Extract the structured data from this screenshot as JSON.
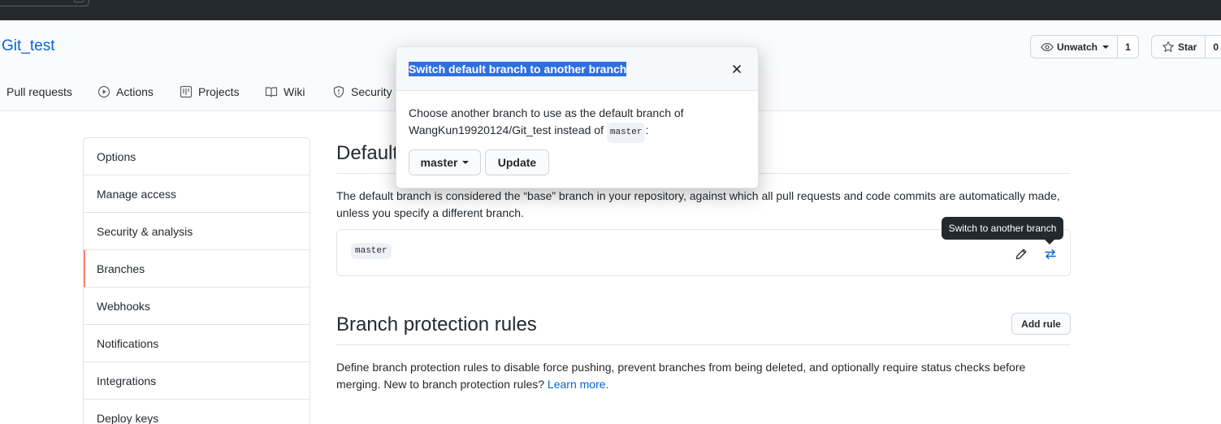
{
  "repo": {
    "name": "Git_test"
  },
  "header_actions": {
    "watch_label": "Unwatch",
    "watch_count": "1",
    "star_label": "Star",
    "star_count": "0"
  },
  "tabs": [
    {
      "label": "Pull requests",
      "icon": "pull-request-icon"
    },
    {
      "label": "Actions",
      "icon": "play-icon"
    },
    {
      "label": "Projects",
      "icon": "project-icon"
    },
    {
      "label": "Wiki",
      "icon": "book-icon"
    },
    {
      "label": "Security",
      "icon": "shield-icon"
    }
  ],
  "sidebar": {
    "items": [
      {
        "label": "Options"
      },
      {
        "label": "Manage access"
      },
      {
        "label": "Security & analysis"
      },
      {
        "label": "Branches",
        "selected": true
      },
      {
        "label": "Webhooks"
      },
      {
        "label": "Notifications"
      },
      {
        "label": "Integrations"
      },
      {
        "label": "Deploy keys"
      }
    ]
  },
  "default_branch": {
    "title": "Default",
    "description": "The default branch is considered the “base” branch in your repository, against which all pull requests and code commits are automatically made, unless you specify a different branch.",
    "branch": "master",
    "edit_icon": "pencil-icon",
    "switch_icon": "arrow-switch-icon",
    "tooltip": "Switch to another branch"
  },
  "protection": {
    "title": "Branch protection rules",
    "add_rule_label": "Add rule",
    "description": "Define branch protection rules to disable force pushing, prevent branches from being deleted, and optionally require status checks before merging. New to branch protection rules?",
    "learn_more": "Learn more."
  },
  "modal": {
    "title": "Switch default branch to another branch",
    "body_line1": "Choose another branch to use as the default branch of",
    "body_repo": "WangKun19920124/Git_test instead of",
    "body_branch": "master",
    "body_suffix": ":",
    "select_label": "master",
    "update_label": "Update"
  },
  "colors": {
    "link": "#0366d6",
    "selected_accent": "#f9826c",
    "topbar": "#24292e",
    "title_highlight": "#2e6fe0"
  }
}
